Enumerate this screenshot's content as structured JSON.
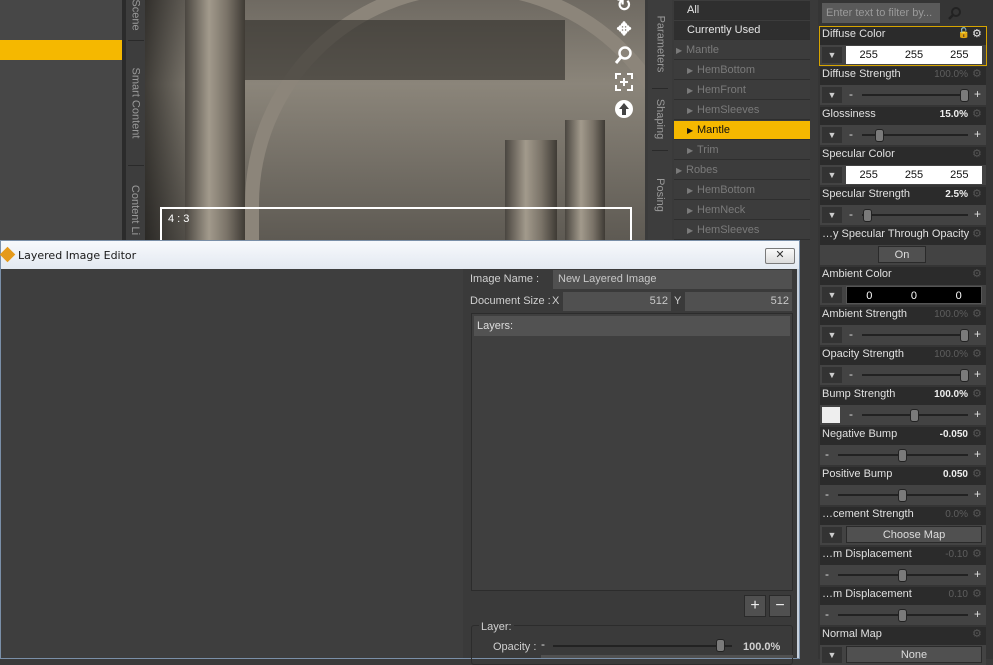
{
  "left_tabs": [
    "Scene",
    "Smart Content",
    "Content Li"
  ],
  "viewport": {
    "aspect_label": "4 : 3",
    "tools": [
      "rotate-icon",
      "move-icon",
      "zoom-icon",
      "frame-icon",
      "up-arrow-icon"
    ]
  },
  "mid_tabs": [
    "Parameters",
    "Shaping",
    "Posing"
  ],
  "tree": {
    "items": [
      {
        "label": "All",
        "level": 0,
        "state": "header",
        "arrow": false
      },
      {
        "label": "Currently Used",
        "level": 0,
        "state": "header",
        "arrow": false
      },
      {
        "label": "Mantle",
        "level": 0,
        "state": "group",
        "arrow": true
      },
      {
        "label": "HemBottom",
        "level": 1,
        "state": "normal",
        "arrow": true
      },
      {
        "label": "HemFront",
        "level": 1,
        "state": "normal",
        "arrow": true
      },
      {
        "label": "HemSleeves",
        "level": 1,
        "state": "normal",
        "arrow": true
      },
      {
        "label": "Mantle",
        "level": 1,
        "state": "selected",
        "arrow": true
      },
      {
        "label": "Trim",
        "level": 1,
        "state": "normal",
        "arrow": true
      },
      {
        "label": "Robes",
        "level": 0,
        "state": "group",
        "arrow": true
      },
      {
        "label": "HemBottom",
        "level": 1,
        "state": "normal",
        "arrow": true
      },
      {
        "label": "HemNeck",
        "level": 1,
        "state": "normal",
        "arrow": true
      },
      {
        "label": "HemSleeves",
        "level": 1,
        "state": "normal",
        "arrow": true
      }
    ]
  },
  "props": {
    "filter_placeholder": "Enter text to filter by...",
    "items": [
      {
        "name": "Diffuse Color",
        "kind": "color",
        "rgb": [
          "255",
          "255",
          "255"
        ],
        "highlight": true
      },
      {
        "name": "Diffuse Strength",
        "kind": "slider",
        "value": "100.0%",
        "dim": true,
        "level": 1.0,
        "dropdown": true
      },
      {
        "name": "Glossiness",
        "kind": "slider",
        "value": "15.0%",
        "dim": false,
        "level": 0.15,
        "dropdown": true
      },
      {
        "name": "Specular Color",
        "kind": "color",
        "rgb": [
          "255",
          "255",
          "255"
        ]
      },
      {
        "name": "Specular Strength",
        "kind": "slider",
        "value": "2.5%",
        "dim": false,
        "level": 0.025,
        "dropdown": true
      },
      {
        "name": "…y Specular Through Opacity",
        "kind": "toggle",
        "button": "On"
      },
      {
        "name": "Ambient Color",
        "kind": "color",
        "rgb": [
          "0",
          "0",
          "0"
        ],
        "black": true
      },
      {
        "name": "Ambient Strength",
        "kind": "slider",
        "value": "100.0%",
        "dim": true,
        "level": 1.0,
        "dropdown": true
      },
      {
        "name": "Opacity Strength",
        "kind": "slider",
        "value": "100.0%",
        "dim": true,
        "level": 1.0,
        "dropdown": true
      },
      {
        "name": "Bump Strength",
        "kind": "slider",
        "value": "100.0%",
        "dim": false,
        "level": 0.5,
        "thumb": true
      },
      {
        "name": "Negative Bump",
        "kind": "slider",
        "value": "-0.050",
        "dim": false,
        "level": 0.5,
        "dropdown": false
      },
      {
        "name": "Positive Bump",
        "kind": "slider",
        "value": "0.050",
        "dim": false,
        "level": 0.5,
        "dropdown": false
      },
      {
        "name": "…cement Strength",
        "kind": "map",
        "value": "0.0%",
        "dim": true,
        "button": "Choose Map"
      },
      {
        "name": "…m Displacement",
        "kind": "slider",
        "value": "-0.10",
        "dim": true,
        "level": 0.5,
        "dropdown": false
      },
      {
        "name": "…m Displacement",
        "kind": "slider",
        "value": "0.10",
        "dim": true,
        "level": 0.5,
        "dropdown": false
      },
      {
        "name": "Normal Map",
        "kind": "map",
        "value": "",
        "dim": true,
        "button": "None"
      }
    ]
  },
  "dialog": {
    "title": "Layered Image Editor",
    "close_label": "✕",
    "image_name_label": "Image Name :",
    "image_name_value": "New Layered Image",
    "doc_size_label": "Document Size :",
    "x_label": "X",
    "x_value": "512",
    "y_label": "Y",
    "y_value": "512",
    "layers_label": "Layers:",
    "add_label": "+",
    "remove_label": "−",
    "layer_label": "Layer:",
    "opacity_label": "Opacity :",
    "opacity_value": "100.0%",
    "opacity_level": 1.0
  },
  "colors": {
    "accent": "#f5b800",
    "panel": "#353535",
    "dialog_frame": "#f0f0f0"
  }
}
